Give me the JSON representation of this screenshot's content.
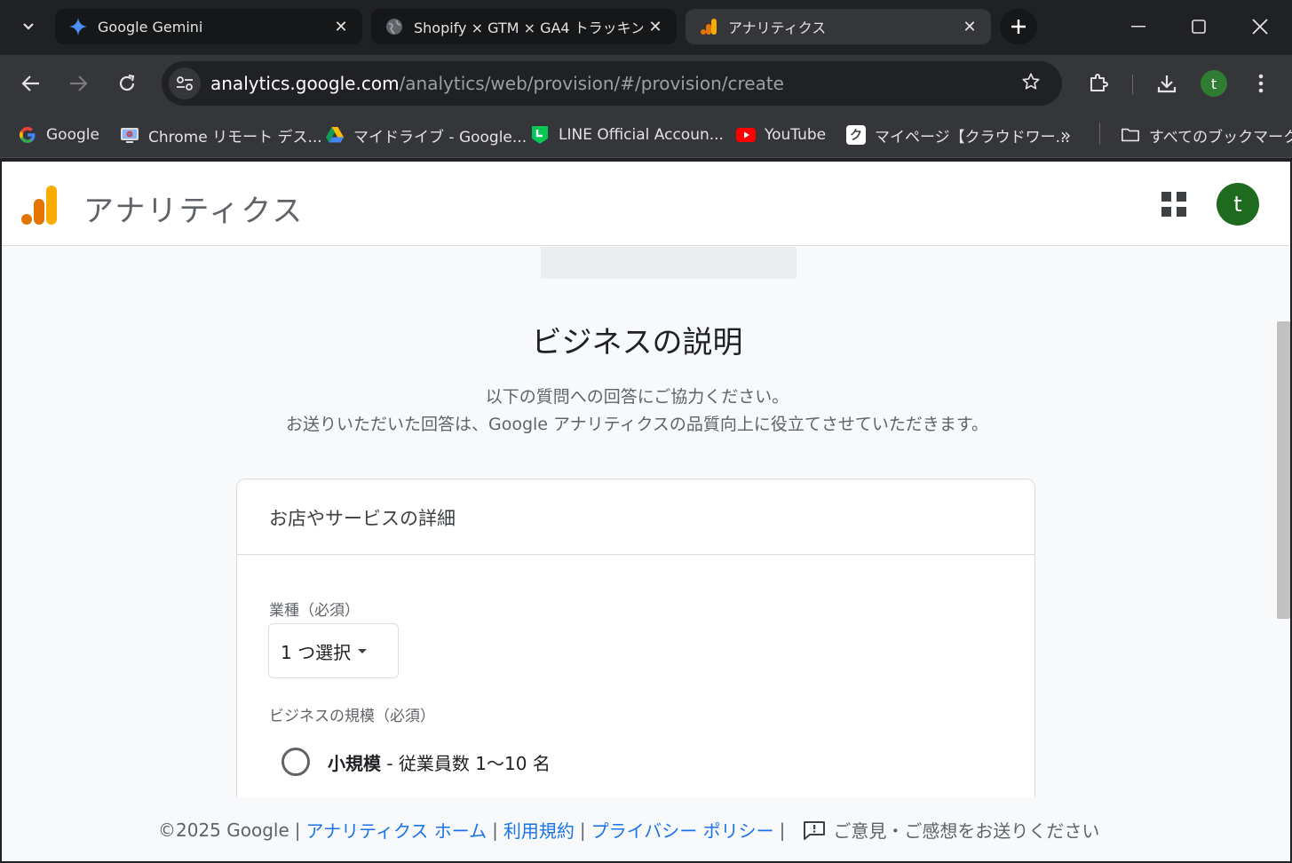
{
  "browser": {
    "tabs": [
      {
        "title": "Google Gemini",
        "icon": "gemini-icon"
      },
      {
        "title": "Shopify × GTM × GA4 トラッキン",
        "icon": "globe-icon"
      },
      {
        "title": "アナリティクス",
        "icon": "analytics-icon"
      }
    ],
    "url_host": "analytics.google.com",
    "url_path": "/analytics/web/provision/#/provision/create",
    "profile_initial": "t",
    "bookmarks": [
      {
        "label": "Google",
        "icon": "google-icon"
      },
      {
        "label": "Chrome リモート デス...",
        "icon": "chrome-remote-icon"
      },
      {
        "label": "マイドライブ - Google...",
        "icon": "drive-icon"
      },
      {
        "label": "LINE Official Accoun...",
        "icon": "line-icon"
      },
      {
        "label": "YouTube",
        "icon": "youtube-icon"
      },
      {
        "label": "マイページ【クラウドワー...",
        "icon": "crowdworks-icon"
      }
    ],
    "overflow_label": "»",
    "all_bookmarks_label": "すべてのブックマーク"
  },
  "app": {
    "title": "アナリティクス",
    "user_initial": "t"
  },
  "main": {
    "heading": "ビジネスの説明",
    "sub_line1": "以下の質問への回答にご協力ください。",
    "sub_line2": "お送りいただいた回答は、Google アナリティクスの品質向上に役立てさせていただきます。"
  },
  "card": {
    "title": "お店やサービスの詳細",
    "industry_label": "業種（必須）",
    "industry_value": "1 つ選択",
    "size_label": "ビジネスの規模（必須）",
    "size_option_bold": "小規模",
    "size_option_rest": " - 従業員数 1〜10 名"
  },
  "footer": {
    "copyright": "©2025 Google",
    "link_home": "アナリティクス ホーム",
    "link_terms": "利用規約",
    "link_privacy": "プライバシー ポリシー",
    "feedback": "ご意見・ご感想をお送りください"
  },
  "colors": {
    "link": "#1a73e8",
    "avatar": "#1e6a1f",
    "analytics_orange": "#f9ab00",
    "analytics_dark_orange": "#e37400"
  }
}
